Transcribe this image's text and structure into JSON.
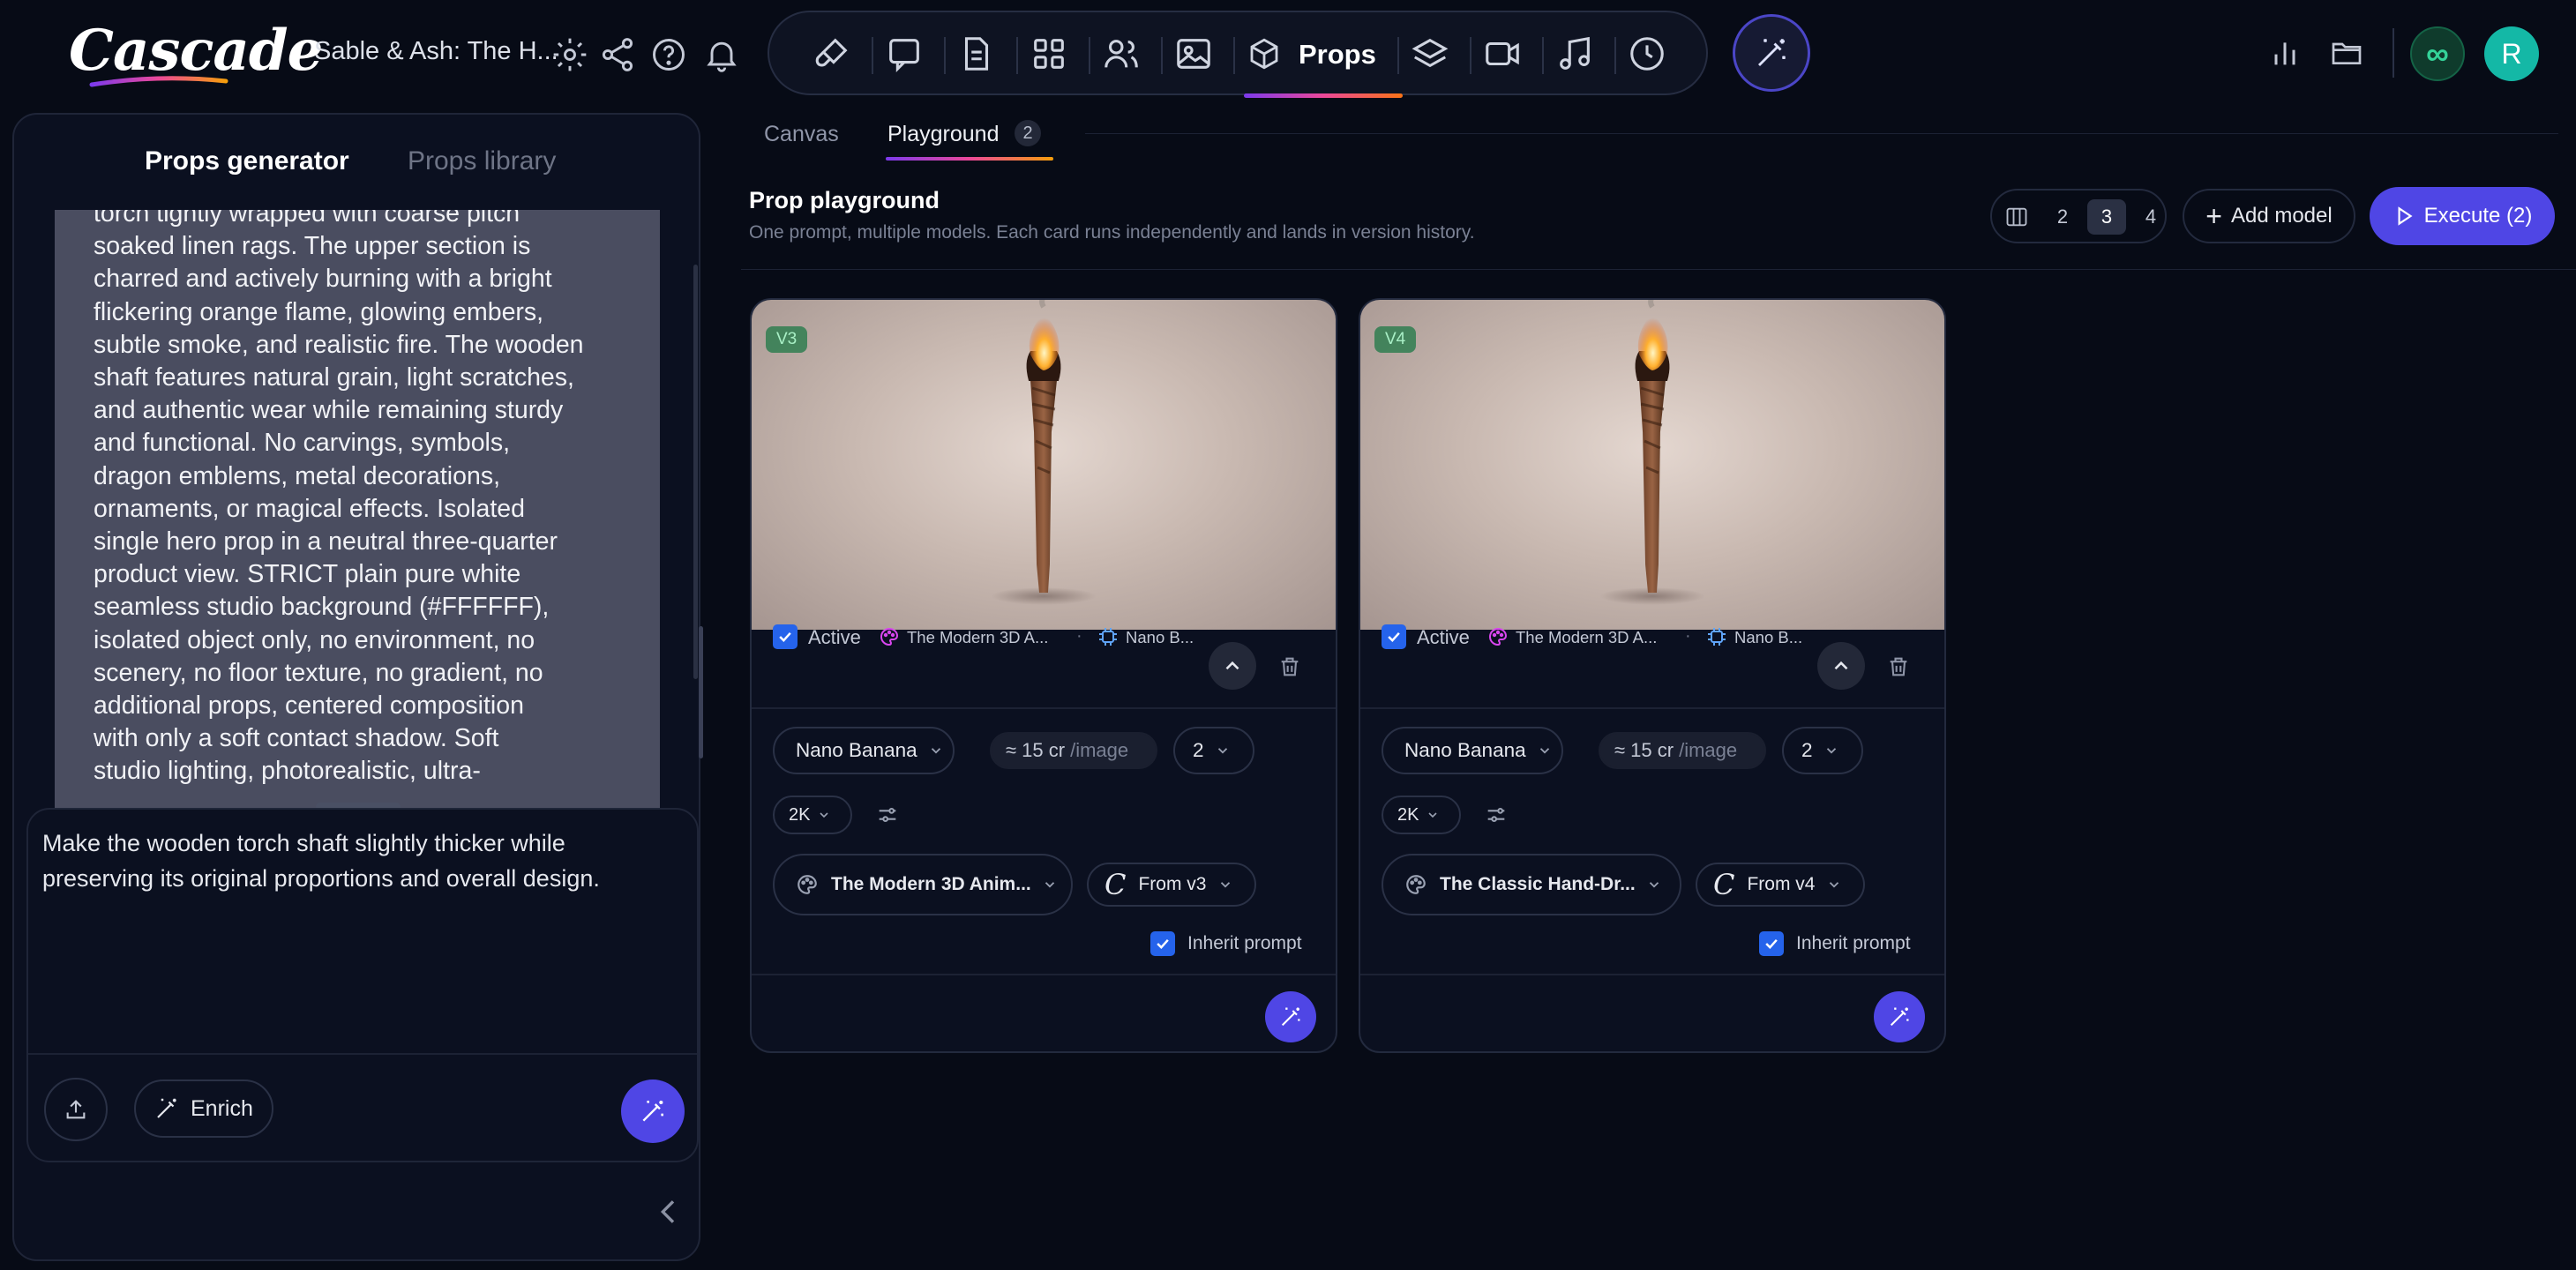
{
  "app": {
    "logo": "Cascade",
    "project_title": "Sable & Ash: The H..."
  },
  "toolbar": {
    "tools": [
      "brush-icon",
      "chat-icon",
      "document-icon",
      "grid-icon",
      "users-icon",
      "image-icon",
      "cube-icon",
      "layers-icon",
      "video-icon",
      "music-icon",
      "history-icon"
    ],
    "active_label": "Props"
  },
  "header_right": {
    "infinity": "∞",
    "avatar": "R"
  },
  "left_panel": {
    "tabs": {
      "generator": "Props generator",
      "library": "Props library"
    },
    "prompt_lines": [
      "torch tightly wrapped with coarse pitch",
      "soaked linen rags. The upper section is",
      "charred and actively burning with a bright",
      "flickering orange flame, glowing embers,",
      "subtle smoke, and realistic fire. The wooden",
      "shaft features natural grain, light scratches,",
      "and authentic wear while remaining sturdy",
      "and functional. No carvings, symbols,",
      "dragon emblems, metal decorations,",
      "ornaments, or magical effects. Isolated",
      "single hero prop in a neutral three-quarter",
      "product view. STRICT plain pure white",
      "seamless studio background (#FFFFFF),",
      "isolated object only, no environment, no",
      "scenery, no floor texture, no gradient, no",
      "additional props, centered composition",
      "with only a soft contact shadow. Soft",
      "studio lighting, photorealistic, ultra-"
    ],
    "edit_text": "Make the wooden torch shaft slightly thicker while preserving its original proportions and overall design.",
    "enrich_label": "Enrich"
  },
  "main": {
    "tabs": {
      "canvas": "Canvas",
      "playground": "Playground",
      "playground_count": "2"
    },
    "title": "Prop playground",
    "subtitle": "One prompt, multiple models. Each card runs independently and lands in version history.",
    "columns": {
      "options": [
        "2",
        "3",
        "4"
      ],
      "selected": "3"
    },
    "add_model": "Add model",
    "execute": "Execute (2)"
  },
  "cards": [
    {
      "version": "V3",
      "active_label": "Active",
      "style_short": "The Modern 3D A...",
      "model_short": "Nano B...",
      "model": "Nano Banana",
      "cost": "≈ 15 cr",
      "cost_unit": "/image",
      "count": "2",
      "resolution": "2K",
      "style": "The Modern 3D Anim...",
      "from": "From v3",
      "inherit_label": "Inherit prompt"
    },
    {
      "version": "V4",
      "active_label": "Active",
      "style_short": "The Modern 3D A...",
      "model_short": "Nano B...",
      "model": "Nano Banana",
      "cost": "≈ 15 cr",
      "cost_unit": "/image",
      "count": "2",
      "resolution": "2K",
      "style": "The Classic Hand-Dr...",
      "from": "From v4",
      "inherit_label": "Inherit prompt"
    }
  ],
  "colors": {
    "accent": "#4f46e5",
    "background": "#070b16",
    "checkbox": "#2563eb",
    "badge": "#34d399",
    "avatar": "#14b8a6"
  }
}
